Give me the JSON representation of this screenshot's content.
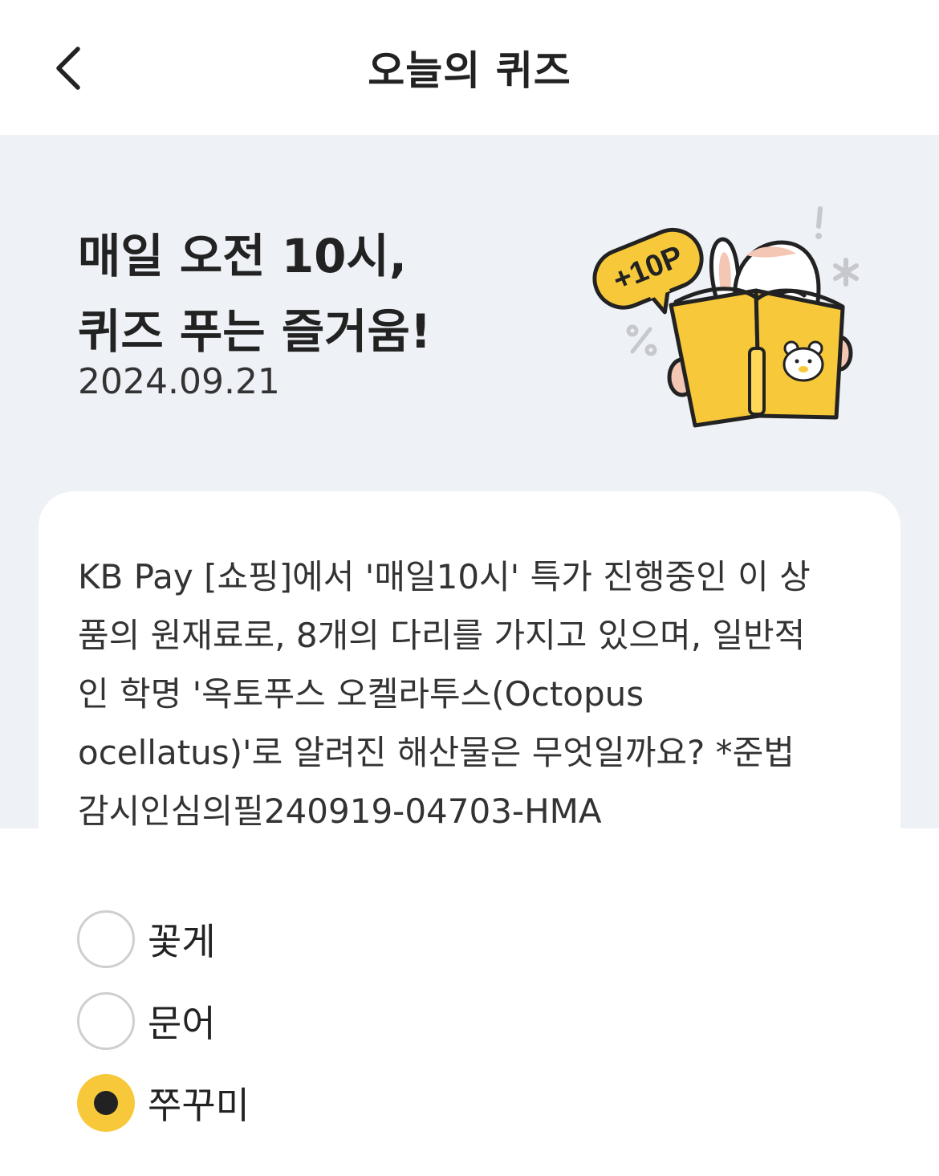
{
  "header": {
    "title": "오늘의 퀴즈",
    "back_icon": "chevron-left-icon"
  },
  "banner": {
    "title_line1": "매일 오전 10시,",
    "title_line2": "퀴즈 푸는 즐거움!",
    "date": "2024.09.21",
    "badge": "+10P",
    "illustration": "rabbit-reading-book"
  },
  "quiz": {
    "lines": [
      "KB Pay [쇼핑]에서 '매일10시' 특가 진행중인 이 상",
      "품의 원재료로, 8개의 다리를 가지고 있으며, 일반적",
      "인 학명 '옥토푸스 오켈라투스(Octopus",
      "ocellatus)'로 알려진 해산물은 무엇일까요? *준법",
      "감시인심의필240919-04703-HMA"
    ]
  },
  "options": [
    {
      "label": "꽃게",
      "selected": false
    },
    {
      "label": "문어",
      "selected": false
    },
    {
      "label": "쭈꾸미",
      "selected": true
    }
  ],
  "colors": {
    "accent": "#f7c93a",
    "banner_bg": "#eef1f6",
    "text": "#222222"
  }
}
